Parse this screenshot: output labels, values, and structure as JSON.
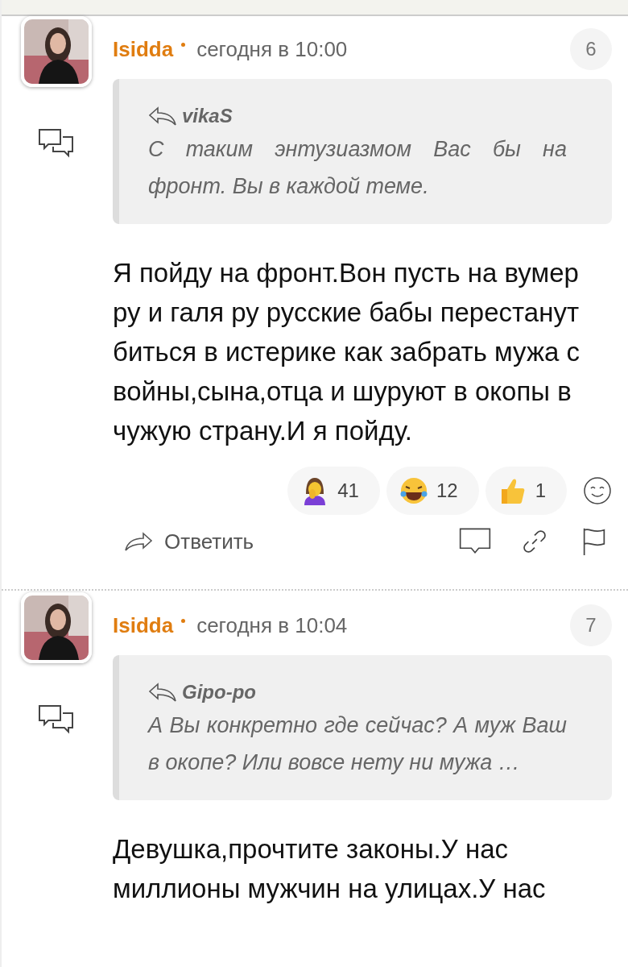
{
  "posts": [
    {
      "author": "Isidda",
      "time": "сегодня в 10:00",
      "number": "6",
      "quote": {
        "author": "vikaS",
        "text": "С таким энтузиазмом Вас бы на фронт. Вы в каждой теме."
      },
      "body": "Я пойду на фронт.Вон пусть на вумер ру и галя ру русские бабы перестанут биться в истерике как забрать мужа с войны,сына,отца и шуруют в окопы в чужую страну.И я пойду.",
      "reactions": [
        {
          "kind": "facepalm",
          "count": "41"
        },
        {
          "kind": "laugh",
          "count": "12"
        },
        {
          "kind": "thumbs-up",
          "count": "1"
        }
      ],
      "reply_label": "Ответить"
    },
    {
      "author": "Isidda",
      "time": "сегодня в 10:04",
      "number": "7",
      "quote": {
        "author": "Gipo-po",
        "text": "А Вы конкретно где сейчас? А муж Ваш в окопе? Или вовсе нету ни мужа …"
      },
      "body": "Девушка,прочтите законы.У нас миллионы мужчин на улицах.У нас"
    }
  ]
}
